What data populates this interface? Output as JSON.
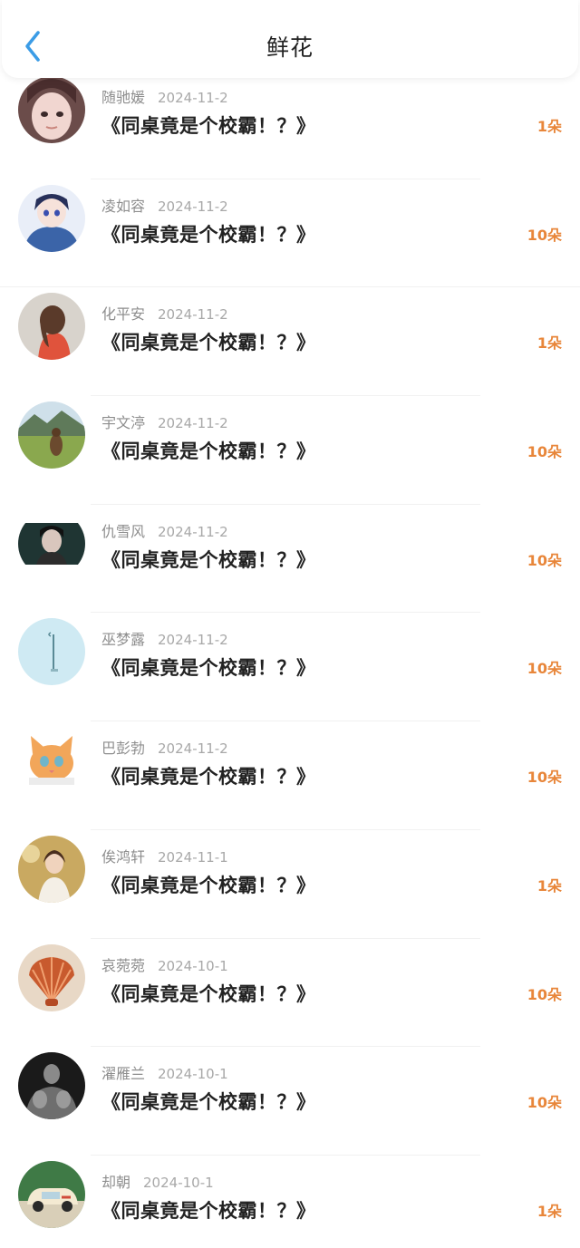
{
  "header": {
    "title": "鲜花",
    "back_icon": "chevron-left-icon",
    "accent": "#3b9ce6"
  },
  "colors": {
    "count": "#e8863a",
    "name": "#8e8e8e",
    "title": "#222222"
  },
  "list": {
    "items": [
      {
        "user": "随驰媛",
        "date": "2024-11-2",
        "book": "《同桌竟是个校霸！？》",
        "count": "1朵"
      },
      {
        "user": "凌如容",
        "date": "2024-11-2",
        "book": "《同桌竟是个校霸！？》",
        "count": "10朵"
      },
      {
        "user": "化平安",
        "date": "2024-11-2",
        "book": "《同桌竟是个校霸！？》",
        "count": "1朵"
      },
      {
        "user": "宇文渟",
        "date": "2024-11-2",
        "book": "《同桌竟是个校霸！？》",
        "count": "10朵"
      },
      {
        "user": "仇雪风",
        "date": "2024-11-2",
        "book": "《同桌竟是个校霸！？》",
        "count": "10朵"
      },
      {
        "user": "巫梦露",
        "date": "2024-11-2",
        "book": "《同桌竟是个校霸！？》",
        "count": "10朵"
      },
      {
        "user": "巴彭勃",
        "date": "2024-11-2",
        "book": "《同桌竟是个校霸！？》",
        "count": "10朵"
      },
      {
        "user": "俟鸿轩",
        "date": "2024-11-1",
        "book": "《同桌竟是个校霸！？》",
        "count": "1朵"
      },
      {
        "user": "哀菀菀",
        "date": "2024-10-1",
        "book": "《同桌竟是个校霸！？》",
        "count": "10朵"
      },
      {
        "user": "濯雁兰",
        "date": "2024-10-1",
        "book": "《同桌竟是个校霸！？》",
        "count": "10朵"
      },
      {
        "user": "却朝",
        "date": "2024-10-1",
        "book": "《同桌竟是个校霸！？》",
        "count": "1朵"
      }
    ]
  }
}
